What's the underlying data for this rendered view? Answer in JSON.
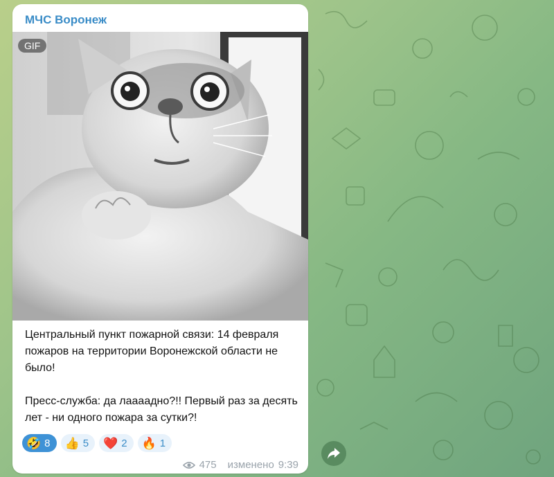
{
  "post": {
    "channel_name": "МЧС Воронеж",
    "media_badge": "GIF",
    "text_para1": "Центральный пункт пожарной связи: 14 февраля пожаров на территории Воронежской области не было!",
    "text_para2": "Пресс-служба: да лаааадно?!! Первый раз за десять лет - ни одного пожара за сутки?!",
    "reactions": [
      {
        "icon": "rofl-emoji",
        "glyph": "🤣",
        "count": "8",
        "active": true
      },
      {
        "icon": "thumbs-up-emoji",
        "glyph": "👍",
        "count": "5",
        "active": false
      },
      {
        "icon": "heart-emoji",
        "glyph": "❤️",
        "count": "2",
        "active": false
      },
      {
        "icon": "fire-emoji",
        "glyph": "🔥",
        "count": "1",
        "active": false
      }
    ],
    "views": "475",
    "edited_label": "изменено",
    "time": "9:39"
  },
  "colors": {
    "channel_name": "#3a8cc7",
    "reaction_active_bg": "#3e92d6",
    "reaction_bg": "#e8f2fb",
    "meta_text": "#9aa3ab"
  }
}
